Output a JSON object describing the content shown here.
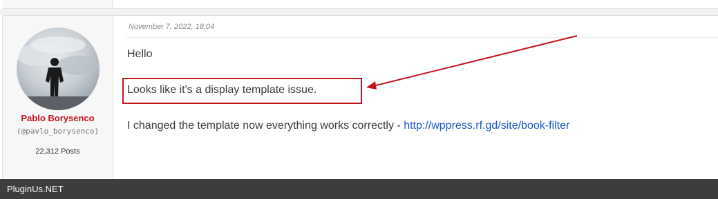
{
  "post": {
    "date": "November 7, 2022, 18:04",
    "author": {
      "name": "Pablo Borysenco",
      "handle": "(@pavlo_borysenco)",
      "posts": "22,312 Posts"
    },
    "content": {
      "line1": "Hello",
      "line2": "Looks like it's a display template issue.",
      "line3_text": "I changed the template now everything works correctly - ",
      "line3_link": "http://wppress.rf.gd/site/book-filter"
    }
  },
  "annotation": {
    "color": "#c0141c",
    "shape": "highlight-box-with-arrow"
  },
  "footer": {
    "brand": "PluginUs.NET"
  },
  "colors": {
    "author_name": "#c8141e",
    "link": "#1a56c4",
    "footer_bg": "#3d3d3d"
  }
}
